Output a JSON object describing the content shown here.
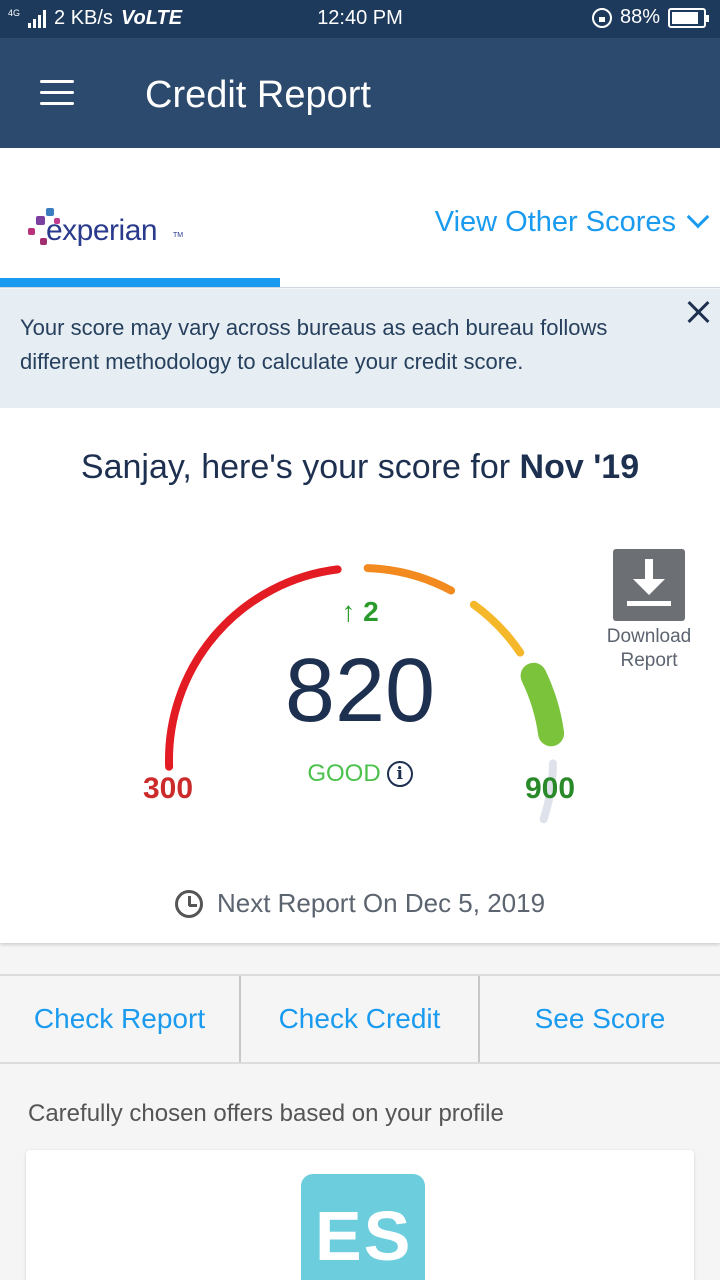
{
  "status_bar": {
    "network_tag": "4G",
    "speed": "2 KB/s",
    "volte": "VoLTE",
    "time": "12:40 PM",
    "battery": "88%",
    "battery_level": 0.88
  },
  "app_bar": {
    "title": "Credit Report"
  },
  "bureau": {
    "logo_text": "experian",
    "logo_tm": "TM",
    "view_other_label": "View Other Scores"
  },
  "info_banner": {
    "text": "Your score may vary across bureaus as each bureau follows different methodology to calculate your credit score."
  },
  "score": {
    "greeting_prefix": "Sanjay, here's your score for ",
    "period": "Nov '19",
    "delta": "2",
    "value": 820,
    "value_label": "820",
    "rating": "GOOD",
    "min": 300,
    "min_label": "300",
    "max": 900,
    "max_label": "900",
    "next_report_label": "Next Report On",
    "next_report_date": "Dec 5, 2019",
    "colors": {
      "red": "#e31b23",
      "orange": "#f38a1f",
      "yellow": "#f5b82a",
      "green": "#7bc33a",
      "grey": "#dfe2ea"
    }
  },
  "download": {
    "line1": "Download",
    "line2": "Report"
  },
  "actions": [
    {
      "label": "Check Report"
    },
    {
      "label": "Check Credit"
    },
    {
      "label": "See Score"
    }
  ],
  "offers": {
    "title": "Carefully chosen offers based on your profile",
    "logo_text": "ES"
  }
}
